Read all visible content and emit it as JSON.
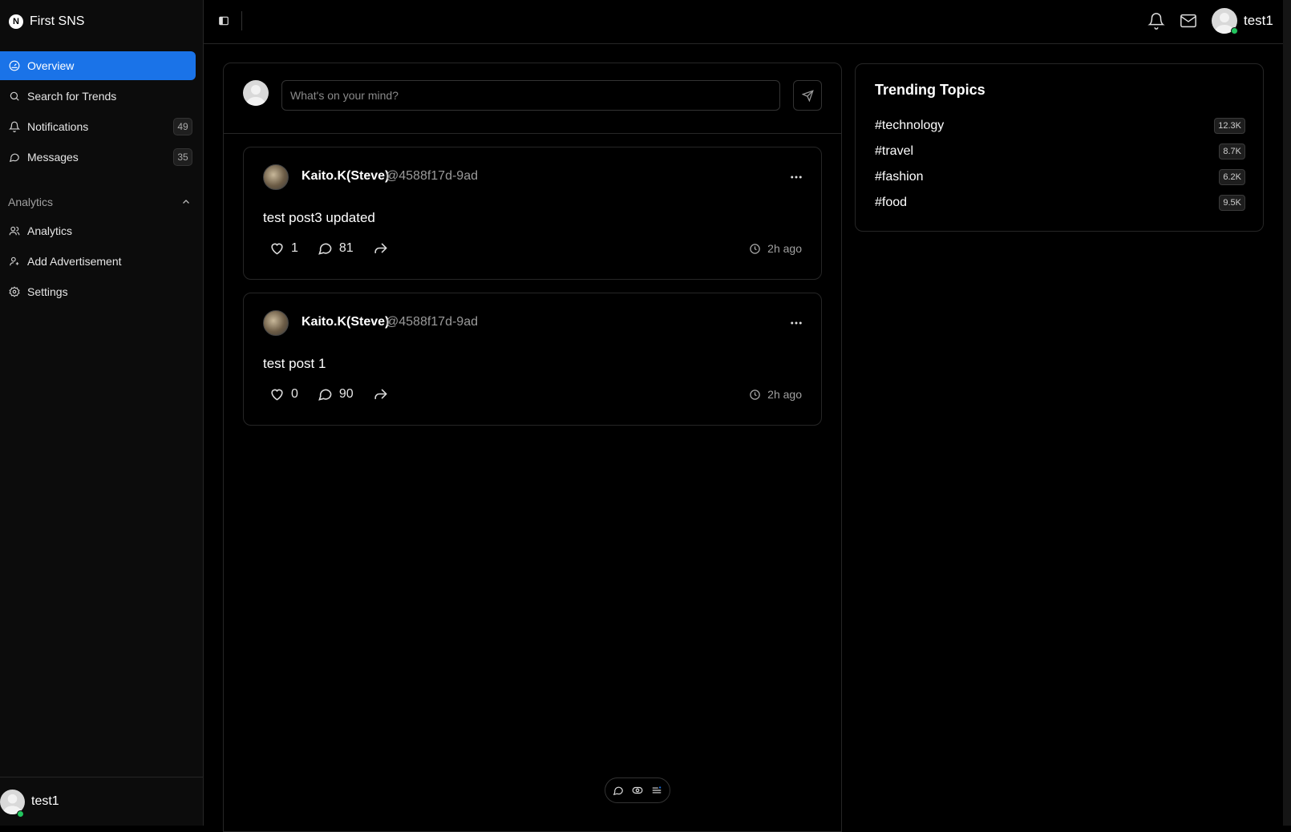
{
  "app": {
    "name": "First SNS",
    "logo_letter": "N"
  },
  "sidebar": {
    "items": [
      {
        "label": "Overview",
        "icon": "gauge-icon",
        "active": true
      },
      {
        "label": "Search for Trends",
        "icon": "search-icon"
      },
      {
        "label": "Notifications",
        "icon": "bell-icon",
        "badge": "49"
      },
      {
        "label": "Messages",
        "icon": "message-icon",
        "badge": "35"
      }
    ],
    "section": {
      "label": "Analytics",
      "expanded": true
    },
    "section_items": [
      {
        "label": "Analytics",
        "icon": "users-icon"
      },
      {
        "label": "Add Advertisement",
        "icon": "user-plus-icon"
      },
      {
        "label": "Settings",
        "icon": "gear-icon"
      }
    ],
    "user": {
      "name": "test1",
      "status": "online"
    }
  },
  "topbar": {
    "user": {
      "name": "test1"
    }
  },
  "composer": {
    "placeholder": "What's on your mind?"
  },
  "posts": [
    {
      "author": "Kaito.K(Steve)",
      "handle": "@4588f17d-9ad",
      "body": "test post3 updated",
      "likes": "1",
      "comments": "81",
      "time": "2h ago"
    },
    {
      "author": "Kaito.K(Steve)",
      "handle": "@4588f17d-9ad",
      "body": "test post 1",
      "likes": "0",
      "comments": "90",
      "time": "2h ago"
    }
  ],
  "trending": {
    "title": "Trending Topics",
    "topics": [
      {
        "tag": "#technology",
        "count": "12.3K"
      },
      {
        "tag": "#travel",
        "count": "8.7K"
      },
      {
        "tag": "#fashion",
        "count": "6.2K"
      },
      {
        "tag": "#food",
        "count": "9.5K"
      }
    ]
  },
  "colors": {
    "accent": "#1a73e8",
    "online": "#22c55e",
    "background": "#000000"
  }
}
